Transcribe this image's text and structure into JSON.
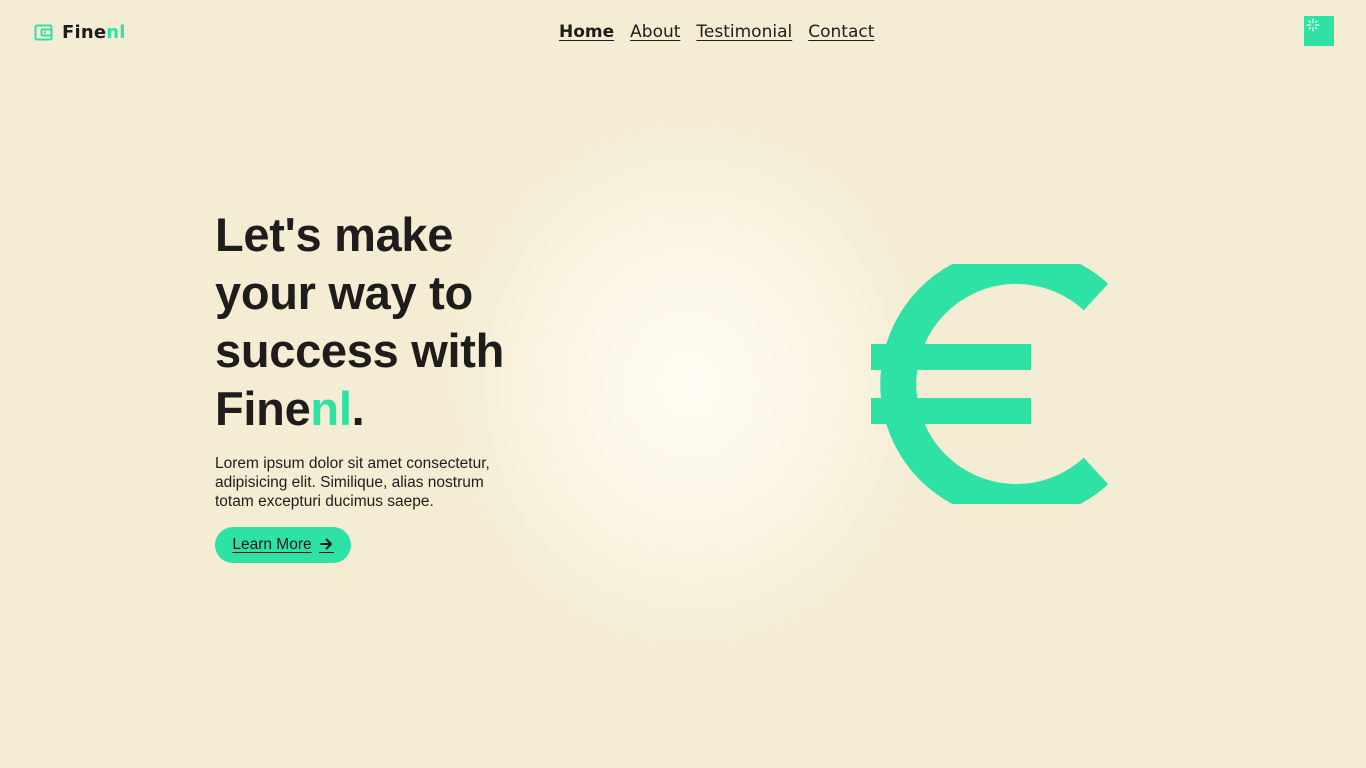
{
  "brand": {
    "name_part1": "Fine",
    "name_part2": "nl",
    "icon": "wallet-icon",
    "accent_color": "#2de2a4",
    "text_color": "#1f1c1c",
    "background_color": "#f4edd3"
  },
  "nav": {
    "items": [
      {
        "label": "Home",
        "active": true
      },
      {
        "label": "About",
        "active": false
      },
      {
        "label": "Testimonial",
        "active": false
      },
      {
        "label": "Contact",
        "active": false
      }
    ]
  },
  "theme_toggle": {
    "icon": "sparkle-icon"
  },
  "hero": {
    "title_line1": "Let's make",
    "title_line2": "your way to",
    "title_line3": "success with",
    "title_brand1": "Fine",
    "title_brand2": "nl",
    "title_period": ".",
    "description": "Lorem ipsum dolor sit amet consectetur, adipisicing elit. Similique, alias nostrum totam excepturi ducimus saepe.",
    "button_label": "Learn More",
    "button_icon": "arrow-right-icon",
    "illustration": "euro-icon"
  }
}
